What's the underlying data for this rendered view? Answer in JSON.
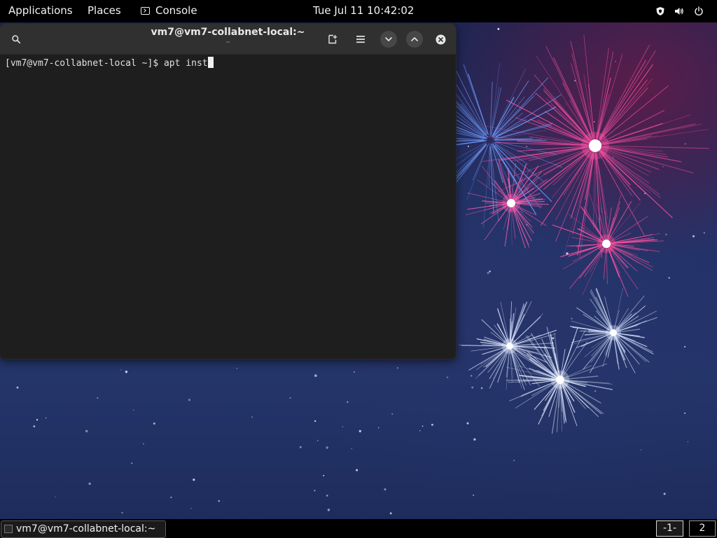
{
  "topbar": {
    "applications": "Applications",
    "places": "Places",
    "console": "Console",
    "clock": "Tue Jul 11  10:42:02",
    "icons": [
      "shield-icon",
      "volume-icon",
      "power-icon"
    ]
  },
  "terminal": {
    "title": "vm7@vm7-collabnet-local:~",
    "subtitle": "~",
    "prompt": "[vm7@vm7-collabnet-local ~]$ ",
    "command": "apt inst",
    "icons": [
      "search-icon",
      "new-tab-icon",
      "hamburger-menu-icon",
      "chevron-down-icon",
      "chevron-up-icon",
      "close-icon"
    ]
  },
  "taskbar": {
    "window_label": "vm7@vm7-collabnet-local:~",
    "workspaces": [
      "-1-",
      "2"
    ]
  },
  "colors": {
    "terminal_bg": "#1e1e1e",
    "header_bg": "#303030",
    "panel_bg": "#000000"
  }
}
